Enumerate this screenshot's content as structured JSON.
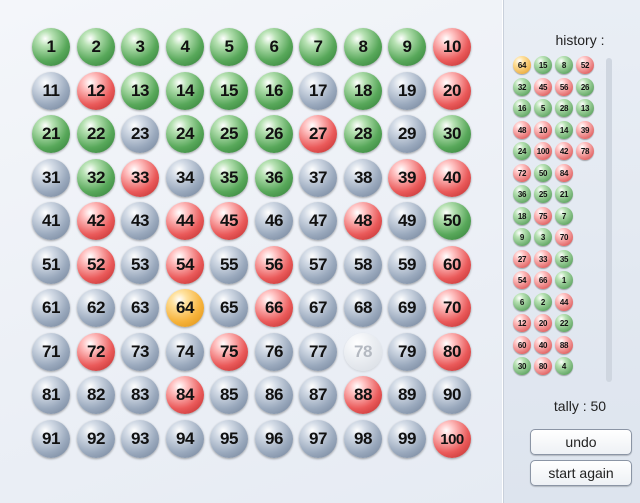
{
  "board": {
    "balls": [
      {
        "n": "1",
        "c": "green"
      },
      {
        "n": "2",
        "c": "green"
      },
      {
        "n": "3",
        "c": "green"
      },
      {
        "n": "4",
        "c": "green"
      },
      {
        "n": "5",
        "c": "green"
      },
      {
        "n": "6",
        "c": "green"
      },
      {
        "n": "7",
        "c": "green"
      },
      {
        "n": "8",
        "c": "green"
      },
      {
        "n": "9",
        "c": "green"
      },
      {
        "n": "10",
        "c": "red"
      },
      {
        "n": "11",
        "c": "grey"
      },
      {
        "n": "12",
        "c": "red"
      },
      {
        "n": "13",
        "c": "green"
      },
      {
        "n": "14",
        "c": "green"
      },
      {
        "n": "15",
        "c": "green"
      },
      {
        "n": "16",
        "c": "green"
      },
      {
        "n": "17",
        "c": "grey"
      },
      {
        "n": "18",
        "c": "green"
      },
      {
        "n": "19",
        "c": "grey"
      },
      {
        "n": "20",
        "c": "red"
      },
      {
        "n": "21",
        "c": "green"
      },
      {
        "n": "22",
        "c": "green"
      },
      {
        "n": "23",
        "c": "grey"
      },
      {
        "n": "24",
        "c": "green"
      },
      {
        "n": "25",
        "c": "green"
      },
      {
        "n": "26",
        "c": "green"
      },
      {
        "n": "27",
        "c": "red"
      },
      {
        "n": "28",
        "c": "green"
      },
      {
        "n": "29",
        "c": "grey"
      },
      {
        "n": "30",
        "c": "green"
      },
      {
        "n": "31",
        "c": "grey"
      },
      {
        "n": "32",
        "c": "green"
      },
      {
        "n": "33",
        "c": "red"
      },
      {
        "n": "34",
        "c": "grey"
      },
      {
        "n": "35",
        "c": "green"
      },
      {
        "n": "36",
        "c": "green"
      },
      {
        "n": "37",
        "c": "grey"
      },
      {
        "n": "38",
        "c": "grey"
      },
      {
        "n": "39",
        "c": "red"
      },
      {
        "n": "40",
        "c": "red"
      },
      {
        "n": "41",
        "c": "grey"
      },
      {
        "n": "42",
        "c": "red"
      },
      {
        "n": "43",
        "c": "grey"
      },
      {
        "n": "44",
        "c": "red"
      },
      {
        "n": "45",
        "c": "red"
      },
      {
        "n": "46",
        "c": "grey"
      },
      {
        "n": "47",
        "c": "grey"
      },
      {
        "n": "48",
        "c": "red"
      },
      {
        "n": "49",
        "c": "grey"
      },
      {
        "n": "50",
        "c": "green"
      },
      {
        "n": "51",
        "c": "grey"
      },
      {
        "n": "52",
        "c": "red"
      },
      {
        "n": "53",
        "c": "grey"
      },
      {
        "n": "54",
        "c": "red"
      },
      {
        "n": "55",
        "c": "grey"
      },
      {
        "n": "56",
        "c": "red"
      },
      {
        "n": "57",
        "c": "grey"
      },
      {
        "n": "58",
        "c": "grey"
      },
      {
        "n": "59",
        "c": "grey"
      },
      {
        "n": "60",
        "c": "red"
      },
      {
        "n": "61",
        "c": "grey"
      },
      {
        "n": "62",
        "c": "grey"
      },
      {
        "n": "63",
        "c": "grey"
      },
      {
        "n": "64",
        "c": "orange"
      },
      {
        "n": "65",
        "c": "grey"
      },
      {
        "n": "66",
        "c": "red"
      },
      {
        "n": "67",
        "c": "grey"
      },
      {
        "n": "68",
        "c": "grey"
      },
      {
        "n": "69",
        "c": "grey"
      },
      {
        "n": "70",
        "c": "red"
      },
      {
        "n": "71",
        "c": "grey"
      },
      {
        "n": "72",
        "c": "red"
      },
      {
        "n": "73",
        "c": "grey"
      },
      {
        "n": "74",
        "c": "grey"
      },
      {
        "n": "75",
        "c": "red"
      },
      {
        "n": "76",
        "c": "grey"
      },
      {
        "n": "77",
        "c": "grey"
      },
      {
        "n": "78",
        "c": "faded"
      },
      {
        "n": "79",
        "c": "grey"
      },
      {
        "n": "80",
        "c": "red"
      },
      {
        "n": "81",
        "c": "grey"
      },
      {
        "n": "82",
        "c": "grey"
      },
      {
        "n": "83",
        "c": "grey"
      },
      {
        "n": "84",
        "c": "red"
      },
      {
        "n": "85",
        "c": "grey"
      },
      {
        "n": "86",
        "c": "grey"
      },
      {
        "n": "87",
        "c": "grey"
      },
      {
        "n": "88",
        "c": "red"
      },
      {
        "n": "89",
        "c": "grey"
      },
      {
        "n": "90",
        "c": "grey"
      },
      {
        "n": "91",
        "c": "grey"
      },
      {
        "n": "92",
        "c": "grey"
      },
      {
        "n": "93",
        "c": "grey"
      },
      {
        "n": "94",
        "c": "grey"
      },
      {
        "n": "95",
        "c": "grey"
      },
      {
        "n": "96",
        "c": "grey"
      },
      {
        "n": "97",
        "c": "grey"
      },
      {
        "n": "98",
        "c": "grey"
      },
      {
        "n": "99",
        "c": "grey"
      },
      {
        "n": "100",
        "c": "red"
      }
    ]
  },
  "history": {
    "title": "history :",
    "rows": [
      [
        {
          "n": "64",
          "c": "orange"
        },
        {
          "n": "15",
          "c": "green"
        },
        {
          "n": "8",
          "c": "green"
        },
        {
          "n": "52",
          "c": "red"
        }
      ],
      [
        {
          "n": "32",
          "c": "green"
        },
        {
          "n": "45",
          "c": "red"
        },
        {
          "n": "56",
          "c": "red"
        },
        {
          "n": "26",
          "c": "green"
        }
      ],
      [
        {
          "n": "16",
          "c": "green"
        },
        {
          "n": "5",
          "c": "green"
        },
        {
          "n": "28",
          "c": "green"
        },
        {
          "n": "13",
          "c": "green"
        }
      ],
      [
        {
          "n": "48",
          "c": "red"
        },
        {
          "n": "10",
          "c": "red"
        },
        {
          "n": "14",
          "c": "green"
        },
        {
          "n": "39",
          "c": "red"
        }
      ],
      [
        {
          "n": "24",
          "c": "green"
        },
        {
          "n": "100",
          "c": "red"
        },
        {
          "n": "42",
          "c": "red"
        },
        {
          "n": "78",
          "c": "red"
        }
      ],
      [
        {
          "n": "72",
          "c": "red"
        },
        {
          "n": "50",
          "c": "green"
        },
        {
          "n": "84",
          "c": "red"
        }
      ],
      [
        {
          "n": "36",
          "c": "green"
        },
        {
          "n": "25",
          "c": "green"
        },
        {
          "n": "21",
          "c": "green"
        }
      ],
      [
        {
          "n": "18",
          "c": "green"
        },
        {
          "n": "75",
          "c": "red"
        },
        {
          "n": "7",
          "c": "green"
        }
      ],
      [
        {
          "n": "9",
          "c": "green"
        },
        {
          "n": "3",
          "c": "green"
        },
        {
          "n": "70",
          "c": "red"
        }
      ],
      [
        {
          "n": "27",
          "c": "red"
        },
        {
          "n": "33",
          "c": "red"
        },
        {
          "n": "35",
          "c": "green"
        }
      ],
      [
        {
          "n": "54",
          "c": "red"
        },
        {
          "n": "66",
          "c": "red"
        },
        {
          "n": "1",
          "c": "green"
        }
      ],
      [
        {
          "n": "6",
          "c": "green"
        },
        {
          "n": "2",
          "c": "green"
        },
        {
          "n": "44",
          "c": "red"
        }
      ],
      [
        {
          "n": "12",
          "c": "red"
        },
        {
          "n": "20",
          "c": "red"
        },
        {
          "n": "22",
          "c": "green"
        }
      ],
      [
        {
          "n": "60",
          "c": "red"
        },
        {
          "n": "40",
          "c": "red"
        },
        {
          "n": "88",
          "c": "red"
        }
      ],
      [
        {
          "n": "30",
          "c": "green"
        },
        {
          "n": "80",
          "c": "red"
        },
        {
          "n": "4",
          "c": "green"
        }
      ]
    ]
  },
  "tally": {
    "text": "tally : 50"
  },
  "buttons": {
    "undo": "undo",
    "start_again": "start again"
  },
  "colors": {
    "grey": "#8a9ab0",
    "green": "#3f8f44",
    "red": "#d53c3c",
    "orange": "#e69a1c",
    "faded": "#d6dbe2"
  }
}
